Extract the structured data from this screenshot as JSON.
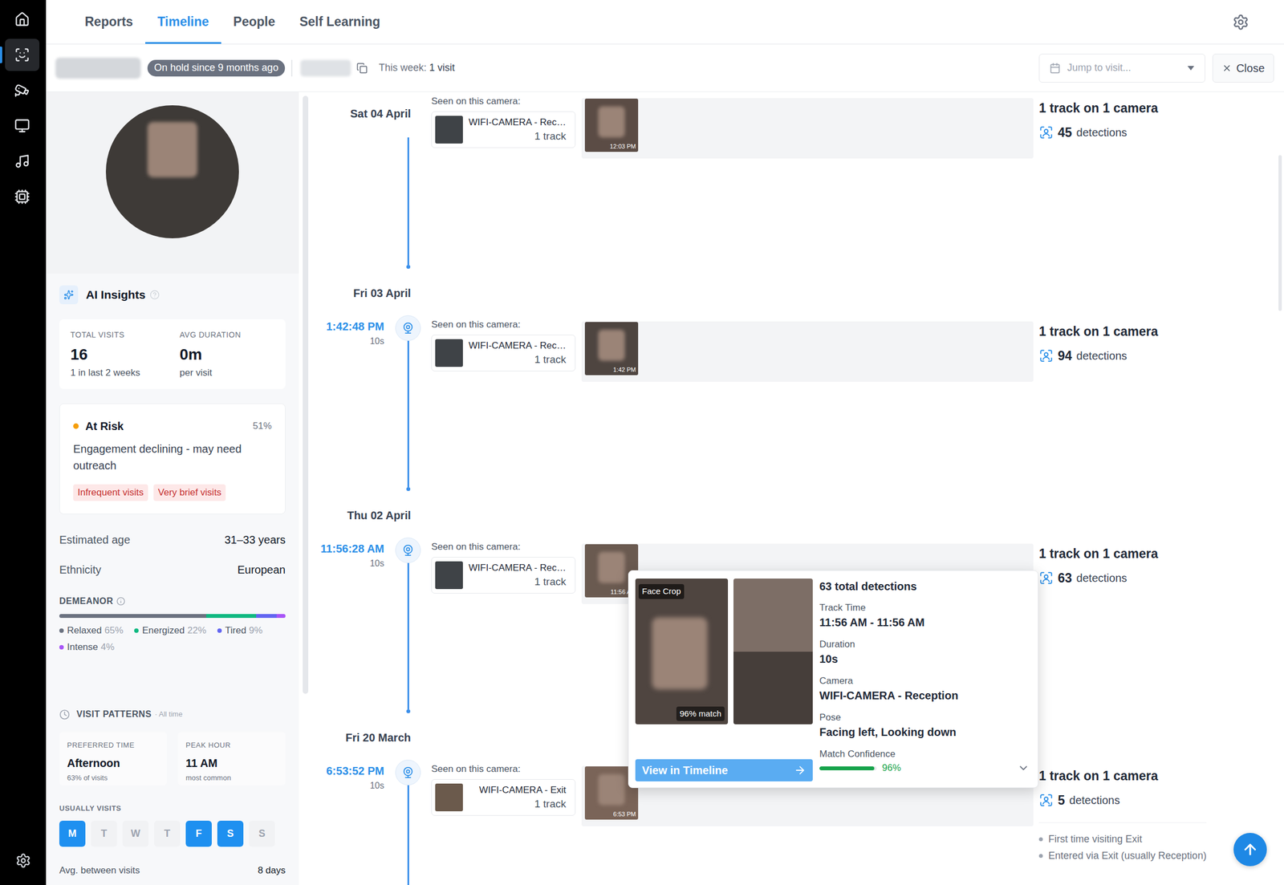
{
  "nav_rail": {
    "items": [
      {
        "selected": false
      },
      {
        "selected": true
      },
      {
        "selected": false
      },
      {
        "selected": false
      },
      {
        "selected": false
      },
      {
        "selected": false
      }
    ]
  },
  "tabs": [
    {
      "label": "Reports",
      "selected": false
    },
    {
      "label": "Timeline",
      "selected": true
    },
    {
      "label": "People",
      "selected": false
    },
    {
      "label": "Self Learning",
      "selected": false
    }
  ],
  "person_bar": {
    "status_badge": "On hold since 9 months ago",
    "week_label": "This week:",
    "week_value": "1 visit",
    "jump": {
      "placeholder": "Jump to visit..."
    },
    "close": "Close"
  },
  "profile": {
    "ai_insights": {
      "title": "AI Insights"
    },
    "stats": [
      {
        "label": "TOTAL VISITS",
        "value": "16",
        "sub": "1 in last 2 weeks"
      },
      {
        "label": "AVG DURATION",
        "value": "0m",
        "sub": "per visit"
      }
    ],
    "risk": {
      "status": "At Risk",
      "percent": "51%",
      "color": "#f59e0b",
      "description": "Engagement declining - may need outreach",
      "tags": [
        "Infrequent visits",
        "Very brief visits"
      ]
    },
    "attributes": [
      {
        "label": "Estimated age",
        "value": "31–33 years"
      },
      {
        "label": "Ethnicity",
        "value": "European"
      }
    ],
    "demeanor": {
      "title": "DEMEANOR",
      "segments": [
        {
          "name": "Relaxed",
          "reading": "65%",
          "level": 0.65,
          "color": "#6b7280"
        },
        {
          "name": "Energized",
          "reading": "22%",
          "level": 0.22,
          "color": "#10b981"
        },
        {
          "name": "Tired",
          "reading": "9%",
          "level": 0.09,
          "color": "#6366f1"
        },
        {
          "name": "Intense",
          "reading": "4%",
          "level": 0.04,
          "color": "#a855f7"
        }
      ]
    },
    "visit_patterns": {
      "title": "VISIT PATTERNS",
      "scope": "· All time",
      "cards": [
        {
          "label": "PREFERRED TIME",
          "value": "Afternoon",
          "sub": "63% of visits"
        },
        {
          "label": "PEAK HOUR",
          "value": "11 AM",
          "sub": "most common"
        }
      ],
      "days_label": "USUALLY VISITS",
      "days": [
        {
          "label": "M",
          "selected": true
        },
        {
          "label": "T",
          "selected": false
        },
        {
          "label": "W",
          "selected": false
        },
        {
          "label": "T",
          "selected": false
        },
        {
          "label": "F",
          "selected": true
        },
        {
          "label": "S",
          "selected": true
        },
        {
          "label": "S",
          "selected": false
        }
      ],
      "avg_between": {
        "label": "Avg. between visits",
        "value": "8 days"
      }
    }
  },
  "timeline": {
    "visits": [
      {
        "date": "Sat 04 April",
        "time": null,
        "duration": null,
        "seen_label": "Seen on this camera:",
        "camera": "WIFI-CAMERA - Rec…",
        "tracks": "1 track",
        "thumb_time": "12:03 PM",
        "summary": "1 track on 1 camera",
        "detections": "45",
        "detections_label": "detections",
        "notes": []
      },
      {
        "date": "Fri 03 April",
        "time": "1:42:48 PM",
        "duration": "10s",
        "seen_label": "Seen on this camera:",
        "camera": "WIFI-CAMERA - Rec…",
        "tracks": "1 track",
        "thumb_time": "1:42 PM",
        "summary": "1 track on 1 camera",
        "detections": "94",
        "detections_label": "detections",
        "notes": []
      },
      {
        "date": "Thu 02 April",
        "time": "11:56:28 AM",
        "duration": "10s",
        "seen_label": "Seen on this camera:",
        "camera": "WIFI-CAMERA - Rec…",
        "tracks": "1 track",
        "thumb_time": "11:56 AM",
        "summary": "1 track on 1 camera",
        "detections": "63",
        "detections_label": "detections",
        "notes": []
      },
      {
        "date": "Fri 20 March",
        "time": "6:53:52 PM",
        "duration": "10s",
        "seen_label": "Seen on this camera:",
        "camera": "WIFI-CAMERA - Exit",
        "tracks": "1 track",
        "thumb_time": "6:53 PM",
        "summary": "1 track on 1 camera",
        "detections": "5",
        "detections_label": "detections",
        "notes": [
          "First time visiting Exit",
          "Entered via Exit (usually Reception)"
        ]
      }
    ]
  },
  "popover": {
    "face_crop_label": "Face Crop",
    "match_badge": "96% match",
    "total": "63 total detections",
    "fields": [
      {
        "label": "Track Time",
        "value": "11:56 AM - 11:56 AM"
      },
      {
        "label": "Duration",
        "value": "10s"
      },
      {
        "label": "Camera",
        "value": "WIFI-CAMERA - Reception"
      },
      {
        "label": "Pose",
        "value": "Facing left, Looking down"
      }
    ],
    "confidence": {
      "label": "Match Confidence",
      "level": 0.96,
      "reading": "96%"
    },
    "button": "View in Timeline"
  }
}
